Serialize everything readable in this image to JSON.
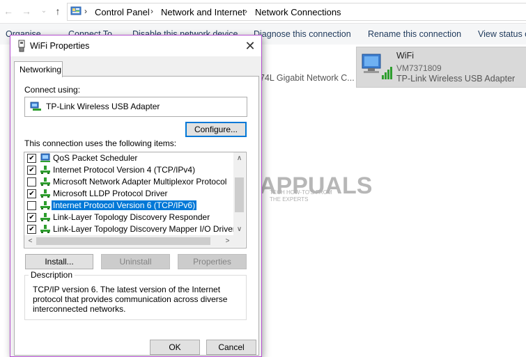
{
  "explorer": {
    "breadcrumbs": [
      "Control Panel",
      "Network and Internet",
      "Network Connections"
    ],
    "commands": [
      "Organise",
      "Connect To",
      "Disable this network device",
      "Diagnose this connection",
      "Rename this connection",
      "View status of"
    ],
    "background_adapter": "74L Gigabit Network C...",
    "wifi_tile": {
      "name": "WiFi",
      "network": "VM7371809",
      "adapter": "TP-Link Wireless USB Adapter"
    },
    "watermark": {
      "brand": "APPUALS",
      "tagline": "TECH HOW-TO'S FROM THE EXPERTS"
    }
  },
  "dialog": {
    "title": "WiFi Properties",
    "tab": "Networking",
    "connect_using_label": "Connect using:",
    "adapter": "TP-Link Wireless USB Adapter",
    "configure_label": "Configure...",
    "items_label": "This connection uses the following items:",
    "items": [
      {
        "label": "QoS Packet Scheduler",
        "checked": true,
        "icon": "qos-icon",
        "selected": false
      },
      {
        "label": "Internet Protocol Version 4 (TCP/IPv4)",
        "checked": true,
        "icon": "protocol-icon",
        "selected": false
      },
      {
        "label": "Microsoft Network Adapter Multiplexor Protocol",
        "checked": false,
        "icon": "protocol-icon",
        "selected": false
      },
      {
        "label": "Microsoft LLDP Protocol Driver",
        "checked": true,
        "icon": "protocol-icon",
        "selected": false
      },
      {
        "label": "Internet Protocol Version 6 (TCP/IPv6)",
        "checked": false,
        "icon": "protocol-icon",
        "selected": true
      },
      {
        "label": "Link-Layer Topology Discovery Responder",
        "checked": true,
        "icon": "protocol-icon",
        "selected": false
      },
      {
        "label": "Link-Layer Topology Discovery Mapper I/O Driver",
        "checked": true,
        "icon": "protocol-icon",
        "selected": false
      }
    ],
    "install_label": "Install...",
    "uninstall_label": "Uninstall",
    "properties_label": "Properties",
    "description_label": "Description",
    "description_text": "TCP/IP version 6. The latest version of the Internet protocol that provides communication across diverse interconnected networks.",
    "ok_label": "OK",
    "cancel_label": "Cancel"
  },
  "colors": {
    "selection": "#0078d7",
    "dialog_border": "#b64fd1",
    "tile_bg": "#d9d9d9"
  }
}
